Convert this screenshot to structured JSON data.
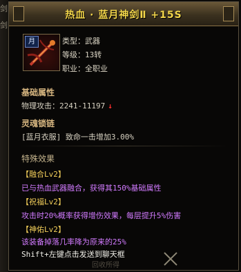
{
  "window_title": "热血 · 蓝月神剑Ⅱ  +15S",
  "left_strip": {
    "labels": [
      "剑",
      "剑"
    ]
  },
  "item": {
    "badge": "月",
    "type_label": "类型：武器",
    "level_label": "等级：13转",
    "class_label": "职业：全职业"
  },
  "sections": {
    "base_title": "基础属性",
    "physical_attack": "物理攻击：2241-11197",
    "soul_lock_title": "灵魂锁链",
    "soul_lock_line": "[蓝月衣服] 致命一击增加3.00%",
    "special_title": "特殊效果"
  },
  "effects": [
    {
      "name": "【融合Lv2】",
      "desc": "已与热血武器融合，获得其150%基础属性"
    },
    {
      "name": "【祝福Lv2】",
      "desc": "攻击时20%概率获得增伤效果，每层提升5%伤害"
    },
    {
      "name": "【神佑Lv2】",
      "desc": "该装备掉落几率降为原来的25%"
    }
  ],
  "footer": {
    "hint": "Shift+左键点击发送到聊天框",
    "faint": "回收所得"
  },
  "colors": {
    "title": "#f2d54a",
    "bracket": "#f2ce5a",
    "purple": "#d27bff",
    "attack_down": "#ff2f2f"
  },
  "icons": {
    "item_icon": "blue-moon-sword-icon",
    "decrease": "down-arrow-icon",
    "decoration": "crossed-blades-icon"
  }
}
